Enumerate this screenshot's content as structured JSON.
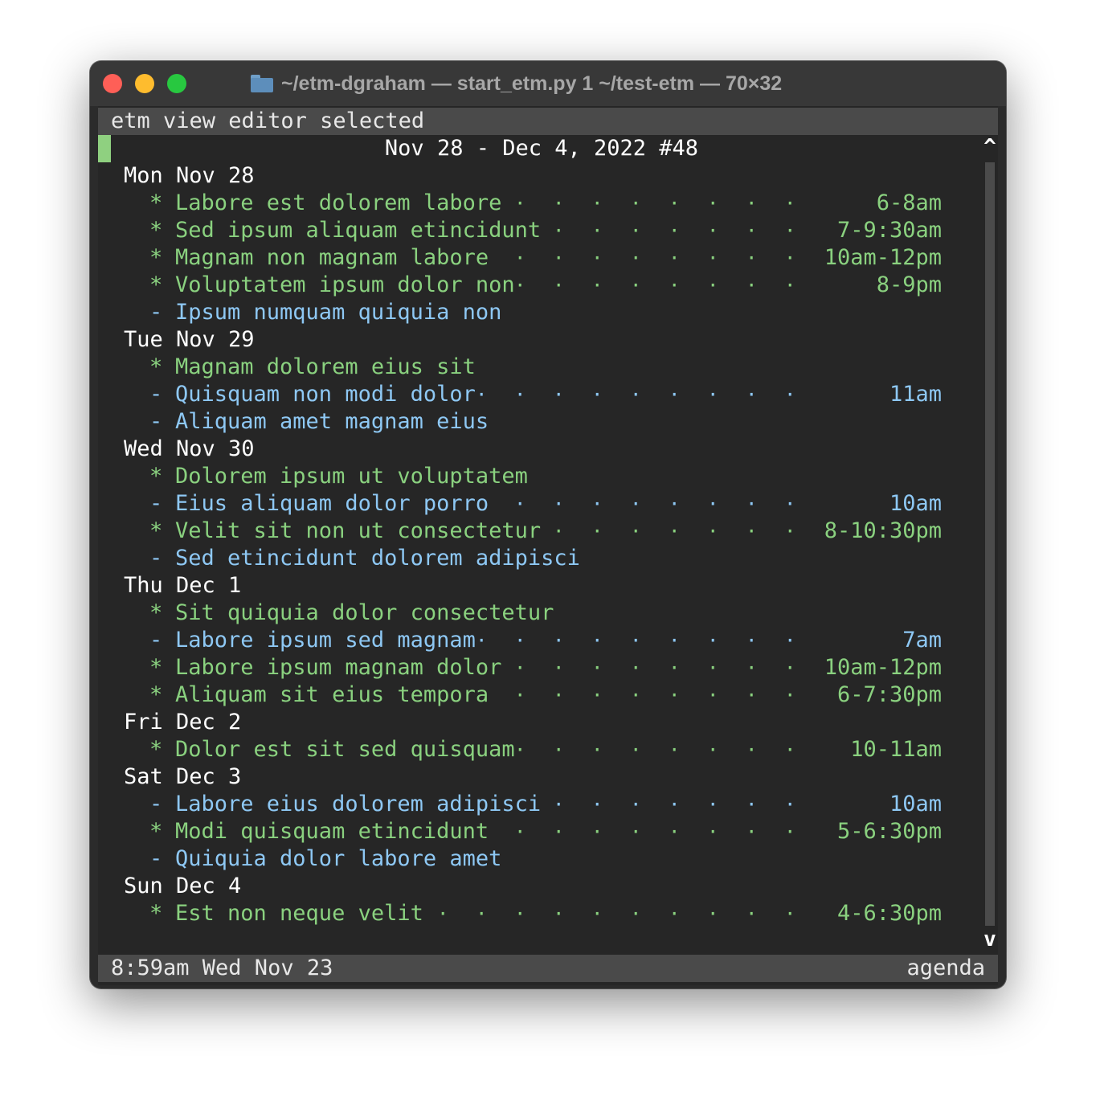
{
  "window": {
    "title": "~/etm-dgraham — start_etm.py 1 ~/test-etm — 70×32"
  },
  "menubar": {
    "text": "etm view editor selected"
  },
  "heading": "Nov 28 - Dec 4, 2022 #48",
  "scroll": {
    "up": "^",
    "down": "v"
  },
  "rows": [
    {
      "kind": "day",
      "text": "Mon Nov 28"
    },
    {
      "kind": "event",
      "mark": "*",
      "label": "Labore est dolorem labore",
      "time": "6-8am"
    },
    {
      "kind": "event",
      "mark": "*",
      "label": "Sed ipsum aliquam etincidunt",
      "time": "7-9:30am"
    },
    {
      "kind": "event",
      "mark": "*",
      "label": "Magnam non magnam labore",
      "time": "10am-12pm"
    },
    {
      "kind": "event",
      "mark": "*",
      "label": "Voluptatem ipsum dolor non",
      "time": "8-9pm"
    },
    {
      "kind": "task",
      "mark": "-",
      "label": "Ipsum numquam quiquia non",
      "time": ""
    },
    {
      "kind": "day",
      "text": "Tue Nov 29"
    },
    {
      "kind": "event",
      "mark": "*",
      "label": "Magnam dolorem eius sit",
      "time": ""
    },
    {
      "kind": "task",
      "mark": "-",
      "label": "Quisquam non modi dolor",
      "time": "11am"
    },
    {
      "kind": "task",
      "mark": "-",
      "label": "Aliquam amet magnam eius",
      "time": ""
    },
    {
      "kind": "day",
      "text": "Wed Nov 30"
    },
    {
      "kind": "event",
      "mark": "*",
      "label": "Dolorem ipsum ut voluptatem",
      "time": ""
    },
    {
      "kind": "task",
      "mark": "-",
      "label": "Eius aliquam dolor porro",
      "time": "10am"
    },
    {
      "kind": "event",
      "mark": "*",
      "label": "Velit sit non ut consectetur",
      "time": "8-10:30pm"
    },
    {
      "kind": "task",
      "mark": "-",
      "label": "Sed etincidunt dolorem adipisci",
      "time": ""
    },
    {
      "kind": "day",
      "text": "Thu Dec 1"
    },
    {
      "kind": "event",
      "mark": "*",
      "label": "Sit quiquia dolor consectetur",
      "time": ""
    },
    {
      "kind": "task",
      "mark": "-",
      "label": "Labore ipsum sed magnam",
      "time": "7am"
    },
    {
      "kind": "event",
      "mark": "*",
      "label": "Labore ipsum magnam dolor",
      "time": "10am-12pm"
    },
    {
      "kind": "event",
      "mark": "*",
      "label": "Aliquam sit eius tempora",
      "time": "6-7:30pm"
    },
    {
      "kind": "day",
      "text": "Fri Dec 2"
    },
    {
      "kind": "event",
      "mark": "*",
      "label": "Dolor est sit sed quisquam",
      "time": "10-11am"
    },
    {
      "kind": "day",
      "text": "Sat Dec 3"
    },
    {
      "kind": "task",
      "mark": "-",
      "label": "Labore eius dolorem adipisci",
      "time": "10am"
    },
    {
      "kind": "event",
      "mark": "*",
      "label": "Modi quisquam etincidunt",
      "time": "5-6:30pm"
    },
    {
      "kind": "task",
      "mark": "-",
      "label": "Quiquia dolor labore amet",
      "time": ""
    },
    {
      "kind": "day",
      "text": "Sun Dec 4"
    },
    {
      "kind": "event",
      "mark": "*",
      "label": "Est non neque velit",
      "time": "4-6:30pm"
    }
  ],
  "statusbar": {
    "left": "8:59am Wed Nov 23",
    "right": "agenda"
  },
  "colors": {
    "event": "#8ad17f",
    "task": "#8ec8f4",
    "day": "#ffffff",
    "bar": "#4a4a4a"
  }
}
